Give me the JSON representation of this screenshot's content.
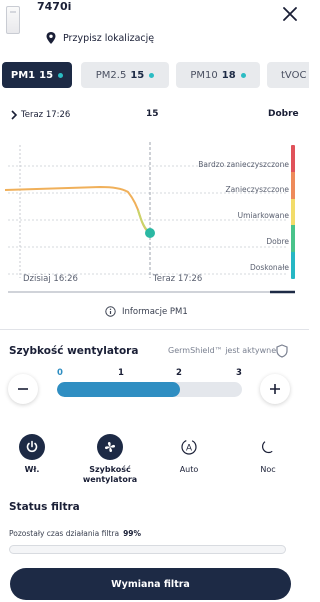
{
  "header": {
    "device_name": "7470i",
    "location_text": "Przypisz lokalizację"
  },
  "tabs": [
    {
      "label": "PM1",
      "value": "15",
      "active": true
    },
    {
      "label": "PM2.5",
      "value": "15",
      "active": false
    },
    {
      "label": "PM10",
      "value": "18",
      "active": false
    },
    {
      "label": "tVOC",
      "value": "",
      "active": false
    }
  ],
  "current": {
    "time_label": "Teraz 17:26",
    "value": "15",
    "quality": "Dobre"
  },
  "chart_data": {
    "type": "line",
    "x": [
      "Dzisiaj 16:26",
      "Teraz 17:26"
    ],
    "series": [
      {
        "values": [
          22,
          22,
          22,
          22,
          21,
          15
        ]
      }
    ],
    "bands": [
      {
        "label": "Bardzo zanieczyszczone",
        "color": "#e0525a"
      },
      {
        "label": "Zanieczyszczone",
        "color": "#ee8a5a"
      },
      {
        "label": "Umiarkowane",
        "color": "#f2dc6a"
      },
      {
        "label": "Dobre",
        "color": "#49c38a"
      },
      {
        "label": "Doskonałe",
        "color": "#26b7c4"
      }
    ],
    "x_start_label": "Dzisiaj 16:26",
    "x_end_label": "Teraz 17:26",
    "current_value": 15
  },
  "info_label": "Informacje PM1",
  "fan": {
    "title": "Szybkość wentylatora",
    "germshield": "GermShield™ jest aktywne",
    "ticks": [
      "0",
      "1",
      "2",
      "3"
    ],
    "level": 2,
    "max": 3
  },
  "modes": [
    {
      "label": "Wł.",
      "icon": "power-icon",
      "active": true
    },
    {
      "label": "Szybkość wentylatora",
      "icon": "fan-icon",
      "active": true
    },
    {
      "label": "Auto",
      "icon": "auto-icon",
      "active": false
    },
    {
      "label": "Noc",
      "icon": "moon-icon",
      "active": false
    }
  ],
  "filter": {
    "title": "Status filtra",
    "remaining_label": "Pozostały czas działania filtra",
    "remaining_value": "99%",
    "button": "Wymiana filtra"
  },
  "colors": {
    "navy": "#1d2a45",
    "accent": "#2f8ec2",
    "teal": "#2bbcc3",
    "line": "#f0b05a"
  }
}
